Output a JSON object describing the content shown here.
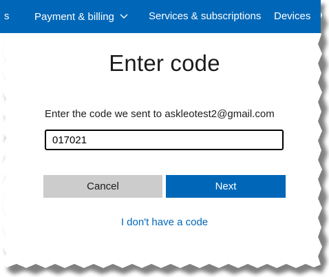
{
  "nav": {
    "partial_item": "s",
    "payment_billing": "Payment & billing",
    "services_subscriptions": "Services & subscriptions",
    "devices": "Devices"
  },
  "page": {
    "title": "Enter code",
    "prompt": "Enter the code we sent to askleotest2@gmail.com",
    "code_value": "017021",
    "cancel_label": "Cancel",
    "next_label": "Next",
    "no_code_link": "I don't have a code"
  },
  "colors": {
    "nav_background": "#0067b8",
    "primary_button": "#0067b8",
    "secondary_button": "#cccccc",
    "link": "#0067b8"
  }
}
